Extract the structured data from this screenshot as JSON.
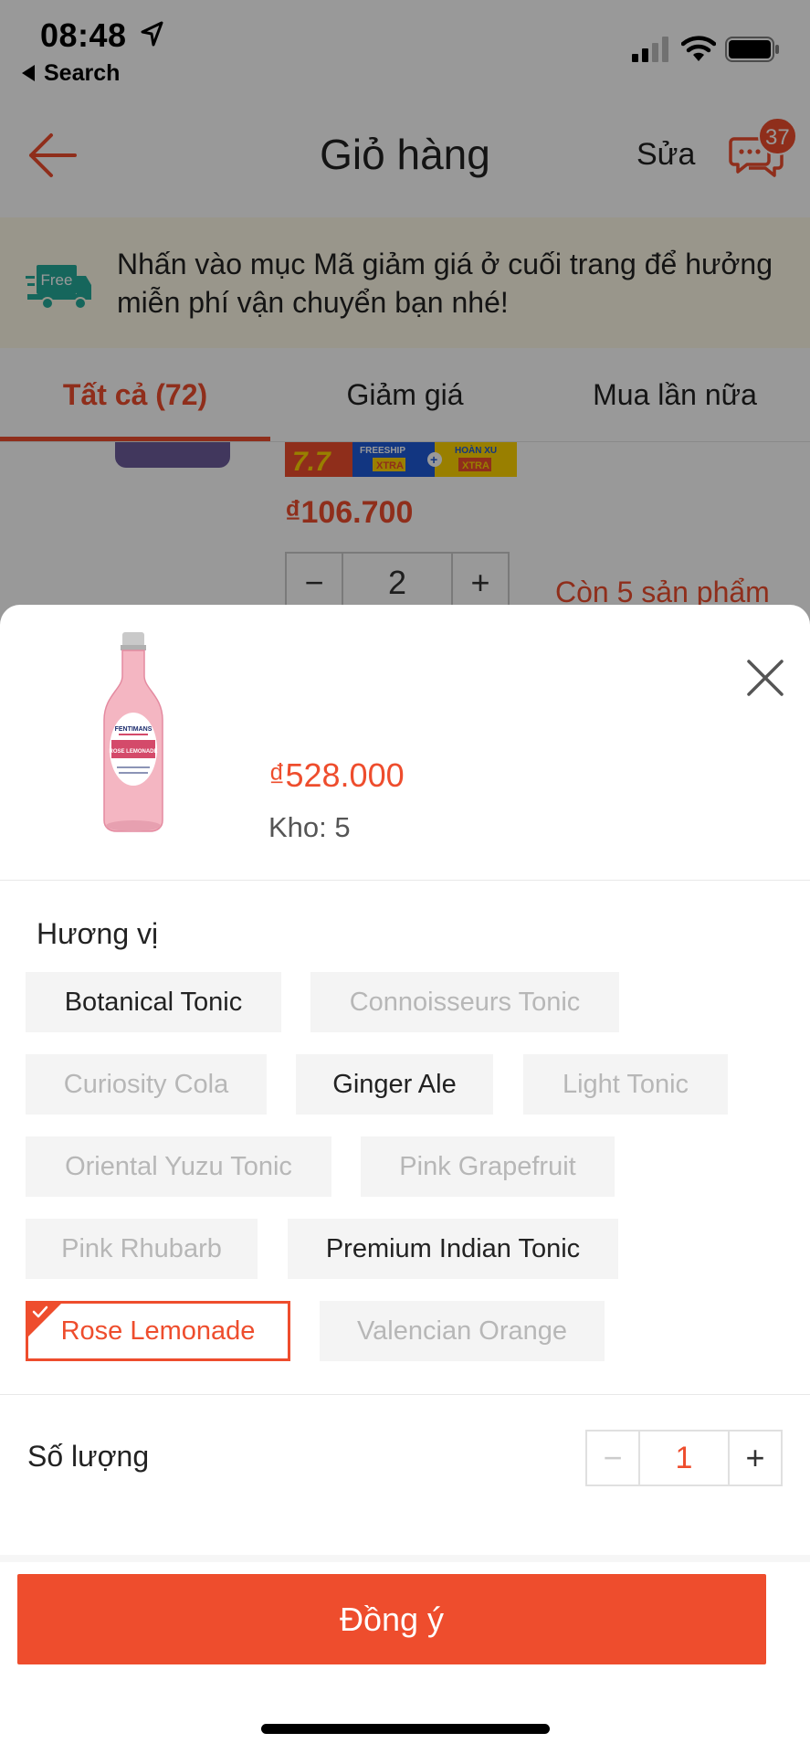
{
  "status_bar": {
    "time": "08:48",
    "back_app": "Search"
  },
  "header": {
    "title": "Giỏ hàng",
    "edit": "Sửa",
    "chat_badge": "37"
  },
  "promo_banner": {
    "truck_label": "Free",
    "text": "Nhấn vào mục Mã giảm giá ở cuối trang để hưởng miễn phí vận chuyển bạn nhé!"
  },
  "tabs": [
    {
      "label": "Tất cả (72)",
      "active": true
    },
    {
      "label": "Giảm giá",
      "active": false
    },
    {
      "label": "Mua lần nữa",
      "active": false
    }
  ],
  "cart_item": {
    "tag_left": "7.7",
    "tag_freeship": "FREESHIP",
    "tag_xtra1": "XTRA",
    "tag_hoanxu": "HOÀN XU",
    "tag_xtra2": "XTRA",
    "price": "₫106.700",
    "minus": "−",
    "quantity": "2",
    "plus": "+",
    "stock_note": "Còn 5 sản phẩm"
  },
  "sheet": {
    "product_image": "Rose Lemonade bottle",
    "bottle_brand": "FENTIMANS",
    "bottle_label": "ROSE LEMONADE",
    "price": "₫528.000",
    "stock": "Kho: 5",
    "variant_title": "Hương vị",
    "variants": [
      {
        "label": "Botanical Tonic",
        "state": "available"
      },
      {
        "label": "Connoisseurs Tonic",
        "state": "disabled"
      },
      {
        "label": "Curiosity Cola",
        "state": "disabled"
      },
      {
        "label": "Ginger Ale",
        "state": "available"
      },
      {
        "label": "Light Tonic",
        "state": "disabled"
      },
      {
        "label": "Oriental Yuzu Tonic",
        "state": "disabled"
      },
      {
        "label": "Pink Grapefruit",
        "state": "disabled"
      },
      {
        "label": "Pink Rhubarb",
        "state": "disabled"
      },
      {
        "label": "Premium Indian Tonic",
        "state": "available"
      },
      {
        "label": "Rose Lemonade",
        "state": "selected"
      },
      {
        "label": "Valencian Orange",
        "state": "disabled"
      }
    ],
    "quantity_label": "Số lượng",
    "quantity_minus": "−",
    "quantity_value": "1",
    "quantity_plus": "+",
    "confirm": "Đồng ý"
  },
  "colors": {
    "accent": "#ee4d2d",
    "promo_bg": "#fffbe8",
    "chip_bg": "#f4f4f4",
    "disabled_text": "#b7b7b7"
  }
}
